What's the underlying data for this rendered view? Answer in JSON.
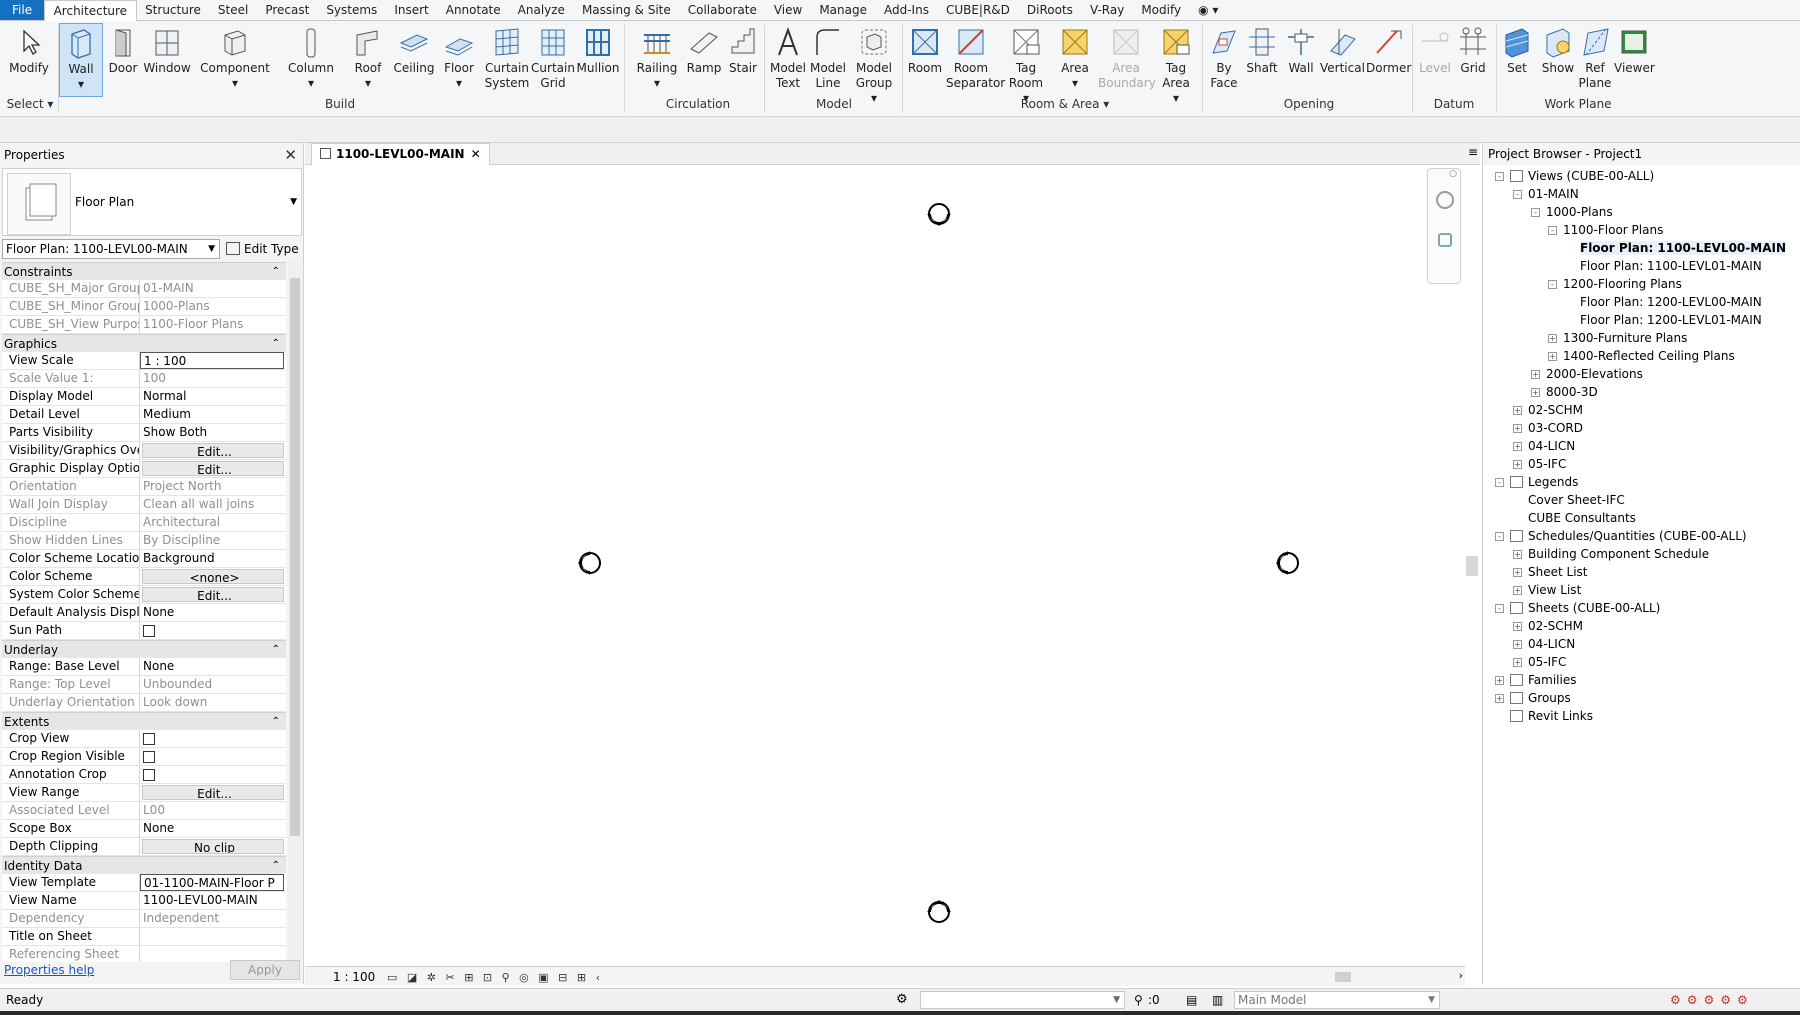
{
  "menu_tabs": [
    "File",
    "Architecture",
    "Structure",
    "Steel",
    "Precast",
    "Systems",
    "Insert",
    "Annotate",
    "Analyze",
    "Massing & Site",
    "Collaborate",
    "View",
    "Manage",
    "Add-Ins",
    "CUBE|R&D",
    "DiRoots",
    "V-Ray",
    "Modify"
  ],
  "ribbon": {
    "select": {
      "modify": "Modify",
      "panel": "Select"
    },
    "build": {
      "wall": "Wall",
      "door": "Door",
      "window": "Window",
      "component": "Component",
      "column": "Column",
      "roof": "Roof",
      "ceiling": "Ceiling",
      "floor": "Floor",
      "curtain_system": "Curtain System",
      "curtain_grid": "Curtain Grid",
      "mullion": "Mullion",
      "panel": "Build"
    },
    "circulation": {
      "railing": "Railing",
      "ramp": "Ramp",
      "stair": "Stair",
      "panel": "Circulation"
    },
    "model": {
      "model_text": "Model Text",
      "model_line": "Model Line",
      "model_group": "Model Group",
      "panel": "Model"
    },
    "room_area": {
      "room": "Room",
      "room_separator": "Room Separator",
      "tag_room": "Tag Room",
      "area": "Area",
      "area_boundary": "Area Boundary",
      "tag_area": "Tag Area",
      "panel": "Room & Area"
    },
    "opening": {
      "by_face": "By Face",
      "shaft": "Shaft",
      "wall": "Wall",
      "vertical": "Vertical",
      "dormer": "Dormer",
      "panel": "Opening"
    },
    "datum": {
      "level": "Level",
      "grid": "Grid",
      "panel": "Datum"
    },
    "work_plane": {
      "set": "Set",
      "show": "Show",
      "ref_plane": "Ref Plane",
      "viewer": "Viewer",
      "panel": "Work Plane"
    }
  },
  "properties": {
    "title": "Properties",
    "type_name": "Floor Plan",
    "instance_selector": "Floor Plan: 1100-LEVL00-MAIN",
    "edit_type": "Edit Type",
    "sections": [
      {
        "name": "Constraints",
        "rows": [
          {
            "k": "CUBE_SH_Major Group",
            "v": "01-MAIN",
            "dim": true
          },
          {
            "k": "CUBE_SH_Minor Group",
            "v": "1000-Plans",
            "dim": true
          },
          {
            "k": "CUBE_SH_View Purpose",
            "v": "1100-Floor Plans",
            "dim": true
          }
        ]
      },
      {
        "name": "Graphics",
        "rows": [
          {
            "k": "View Scale",
            "v": "1 : 100",
            "box": true
          },
          {
            "k": "Scale Value    1:",
            "v": "100",
            "dim": true
          },
          {
            "k": "Display Model",
            "v": "Normal"
          },
          {
            "k": "Detail Level",
            "v": "Medium"
          },
          {
            "k": "Parts Visibility",
            "v": "Show Both"
          },
          {
            "k": "Visibility/Graphics Ove...",
            "v": "Edit...",
            "btn": true
          },
          {
            "k": "Graphic Display Options",
            "v": "Edit...",
            "btn": true
          },
          {
            "k": "Orientation",
            "v": "Project North",
            "dim": true
          },
          {
            "k": "Wall Join Display",
            "v": "Clean all wall joins",
            "dim": true
          },
          {
            "k": "Discipline",
            "v": "Architectural",
            "dim": true
          },
          {
            "k": "Show Hidden Lines",
            "v": "By Discipline",
            "dim": true
          },
          {
            "k": "Color Scheme Location",
            "v": "Background"
          },
          {
            "k": "Color Scheme",
            "v": "<none>",
            "btn": true
          },
          {
            "k": "System Color Schemes",
            "v": "Edit...",
            "btn": true
          },
          {
            "k": "Default Analysis Displa...",
            "v": "None"
          },
          {
            "k": "Sun Path",
            "v": "",
            "chk": true
          }
        ]
      },
      {
        "name": "Underlay",
        "rows": [
          {
            "k": "Range: Base Level",
            "v": "None"
          },
          {
            "k": "Range: Top Level",
            "v": "Unbounded",
            "dim": true
          },
          {
            "k": "Underlay Orientation",
            "v": "Look down",
            "dim": true
          }
        ]
      },
      {
        "name": "Extents",
        "rows": [
          {
            "k": "Crop View",
            "v": "",
            "chk": true
          },
          {
            "k": "Crop Region Visible",
            "v": "",
            "chk": true
          },
          {
            "k": "Annotation Crop",
            "v": "",
            "chk": true
          },
          {
            "k": "View Range",
            "v": "Edit...",
            "btn": true
          },
          {
            "k": "Associated Level",
            "v": "L00",
            "dim": true
          },
          {
            "k": "Scope Box",
            "v": "None"
          },
          {
            "k": "Depth Clipping",
            "v": "No clip",
            "btn": true
          }
        ]
      },
      {
        "name": "Identity Data",
        "rows": [
          {
            "k": "View Template",
            "v": "01-1100-MAIN-Floor P",
            "box": true
          },
          {
            "k": "View Name",
            "v": "1100-LEVL00-MAIN"
          },
          {
            "k": "Dependency",
            "v": "Independent",
            "dim": true
          },
          {
            "k": "Title on Sheet",
            "v": ""
          },
          {
            "k": "Referencing Sheet",
            "v": "",
            "dim": true
          }
        ]
      }
    ],
    "help": "Properties help",
    "apply": "Apply"
  },
  "view_tab": {
    "title": "1100-LEVL00-MAIN"
  },
  "view_control": {
    "scale": "1 : 100"
  },
  "browser": {
    "title": "Project Browser - Project1",
    "nodes": [
      {
        "t": "Views (CUBE-00-ALL)",
        "lvl": 0,
        "pm": "-",
        "icon": true
      },
      {
        "t": "01-MAIN",
        "lvl": 1,
        "pm": "-"
      },
      {
        "t": "1000-Plans",
        "lvl": 2,
        "pm": "-"
      },
      {
        "t": "1100-Floor Plans",
        "lvl": 3,
        "pm": "-"
      },
      {
        "t": "Floor Plan: 1100-LEVL00-MAIN",
        "lvl": 4,
        "sel": true
      },
      {
        "t": "Floor Plan: 1100-LEVL01-MAIN",
        "lvl": 4
      },
      {
        "t": "1200-Flooring Plans",
        "lvl": 3,
        "pm": "-"
      },
      {
        "t": "Floor Plan: 1200-LEVL00-MAIN",
        "lvl": 4
      },
      {
        "t": "Floor Plan: 1200-LEVL01-MAIN",
        "lvl": 4
      },
      {
        "t": "1300-Furniture Plans",
        "lvl": 3,
        "pm": "+"
      },
      {
        "t": "1400-Reflected Ceiling Plans",
        "lvl": 3,
        "pm": "+"
      },
      {
        "t": "2000-Elevations",
        "lvl": 2,
        "pm": "+"
      },
      {
        "t": "8000-3D",
        "lvl": 2,
        "pm": "+"
      },
      {
        "t": "02-SCHM",
        "lvl": 1,
        "pm": "+"
      },
      {
        "t": "03-CORD",
        "lvl": 1,
        "pm": "+"
      },
      {
        "t": "04-LICN",
        "lvl": 1,
        "pm": "+"
      },
      {
        "t": "05-IFC",
        "lvl": 1,
        "pm": "+"
      },
      {
        "t": "Legends",
        "lvl": 0,
        "pm": "-",
        "icon": true
      },
      {
        "t": "Cover Sheet-IFC",
        "lvl": 1
      },
      {
        "t": "CUBE Consultants",
        "lvl": 1
      },
      {
        "t": "Schedules/Quantities (CUBE-00-ALL)",
        "lvl": 0,
        "pm": "-",
        "icon": true
      },
      {
        "t": "Building Component Schedule",
        "lvl": 1,
        "pm": "+"
      },
      {
        "t": "Sheet List",
        "lvl": 1,
        "pm": "+"
      },
      {
        "t": "View List",
        "lvl": 1,
        "pm": "+"
      },
      {
        "t": "Sheets (CUBE-00-ALL)",
        "lvl": 0,
        "pm": "-",
        "icon": true
      },
      {
        "t": "02-SCHM",
        "lvl": 1,
        "pm": "+"
      },
      {
        "t": "04-LICN",
        "lvl": 1,
        "pm": "+"
      },
      {
        "t": "05-IFC",
        "lvl": 1,
        "pm": "+"
      },
      {
        "t": "Families",
        "lvl": 0,
        "pm": "+",
        "icon": true
      },
      {
        "t": "Groups",
        "lvl": 0,
        "pm": "+",
        "icon": true
      },
      {
        "t": "Revit Links",
        "lvl": 0,
        "icon": true
      }
    ]
  },
  "status": {
    "text": "Ready",
    "zero": ":0",
    "model": "Main Model"
  },
  "colors": {
    "accent": "#1570c2",
    "selected_bg": "#cfe4f6"
  }
}
